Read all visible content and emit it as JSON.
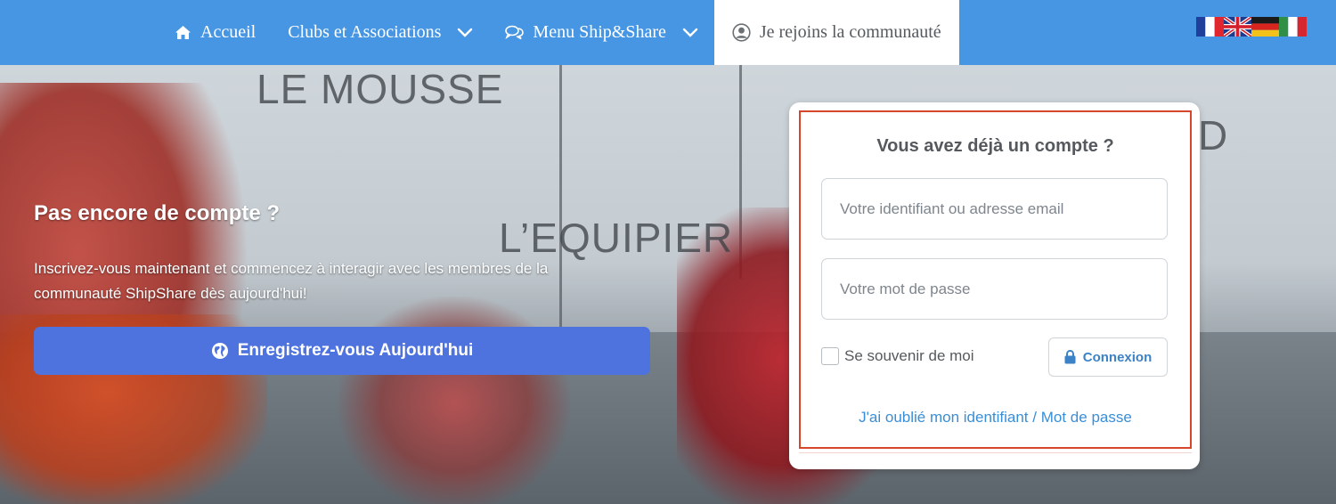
{
  "nav": {
    "items": [
      {
        "label": "Accueil",
        "icon": "home-icon"
      },
      {
        "label": "Clubs et Associations",
        "icon": "chevron-down-icon"
      },
      {
        "label": "Menu Ship&Share",
        "icon": "chat-bubbles-icon"
      },
      {
        "label": "Je rejoins la communauté",
        "icon": "user-circle-icon"
      }
    ],
    "languages": [
      "fr",
      "en",
      "de",
      "it"
    ]
  },
  "hero": {
    "watermarks": [
      "LE MOUSSE",
      "L’EQUIPIER",
      "D"
    ]
  },
  "signup": {
    "title": "Pas encore de compte ?",
    "text": "Inscrivez-vous maintenant et commencez à interagir avec les membres de la communauté ShipShare dès aujourd'hui!",
    "button_label": "Enregistrez-vous Aujourd'hui",
    "button_icon": "globe-icon"
  },
  "login": {
    "title": "Vous avez déjà un compte ?",
    "username_placeholder": "Votre identifiant ou adresse email",
    "password_placeholder": "Votre mot de passe",
    "remember_label": "Se souvenir de moi",
    "submit_label": "Connexion",
    "submit_icon": "lock-icon",
    "forgot_username": "J'ai oublié mon identifiant",
    "forgot_separator": "/",
    "forgot_password": "Mot de passe"
  },
  "colors": {
    "nav_bg": "#4796e3",
    "register_button": "#4e73df",
    "link": "#3a8ed6",
    "frame_highlight": "#d6462a"
  }
}
